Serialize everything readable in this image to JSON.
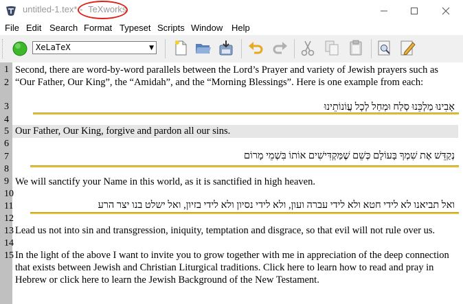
{
  "window": {
    "file_title": "untitled-1.tex*",
    "separator": " - ",
    "app_name": "TeXworks"
  },
  "menu": [
    "File",
    "Edit",
    "Search",
    "Format",
    "Typeset",
    "Scripts",
    "Window",
    "Help"
  ],
  "toolbar": {
    "engine": "XeLaTeX",
    "icons": [
      "play-icon",
      "new-document-icon",
      "open-folder-icon",
      "save-icon",
      "undo-icon",
      "redo-icon",
      "cut-icon",
      "copy-icon",
      "paste-icon",
      "find-icon",
      "edit-icon"
    ]
  },
  "editor": {
    "line_numbers": [
      "1",
      "2",
      "3",
      "4",
      "5",
      "6",
      "7",
      "8",
      "9",
      "10",
      "11",
      "12",
      "13",
      "14",
      "15"
    ],
    "lines": {
      "l1a": "Second, there are word-by-word parallels between the Lord’s Prayer and variety of Jewish prayers such as",
      "l1b": "“Our Father, Our King”, the “Amidah”, and the “Morning Blessings”. Here is one example from each:",
      "l3": "אָבִינוּ מַלְכֵּנוּ סְלַח וּמְחַל לְכָל עֲוֹנוֹתֵינוּ",
      "l5": "Our Father, Our King, forgive and pardon all our sins.",
      "l7": "נְקַדֵּשׁ אֶת שִׁמְךָ בָּעוֹלָם כְּשֵׁם שֶׁמַּקְדִּישִׁים אוֹתוֹ בִּשְׁמֵי מָרוֹם",
      "l9": "We will sanctify your Name in this world, as it is sanctified in high heaven.",
      "l11": "ואל תביאנו לא לידי חטא ולא לידי עברה ועון, ולא לידי נסיון ולא לידי בזיון, ואל ישלט בנו יצר הרע",
      "l13": "Lead us not into sin and transgression, iniquity, temptation and disgrace, so that evil will not rule over us.",
      "l15a": "In the light of the above I want to invite you to grow together with me in appreciation of the deep connection",
      "l15b": "that exists between Jewish and Christian Liturgical traditions. Click here to learn how to read and pray in",
      "l15c": "Hebrew or click here to learn the Jewish Background of the New Testament."
    }
  },
  "colors": {
    "annotation_circle": "#e0201a",
    "underline": "#e7c43a",
    "current_line": "#e6e6e6",
    "gutter": "#c0c0c0"
  }
}
